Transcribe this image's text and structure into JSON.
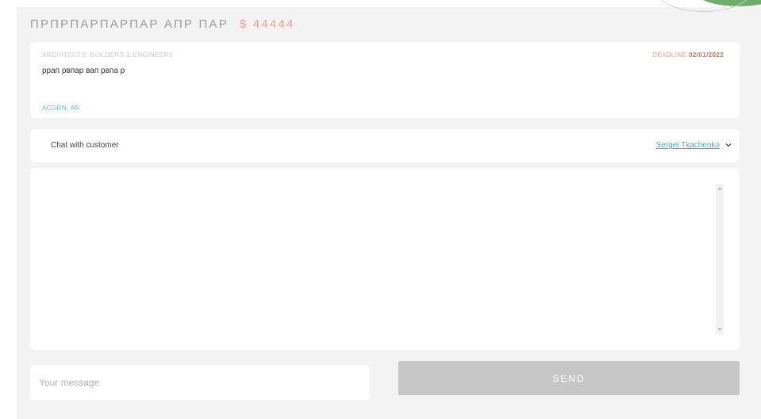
{
  "header": {
    "title": "ПРПРПАРПАРПАР АПР ПАР",
    "price": "$ 44444"
  },
  "job": {
    "category": "ARCHITECTS, BUILDERS & ENGINEERS",
    "deadline_label": "DEADLINE",
    "deadline_date": "02/01/2022",
    "description": "ppап рвпар вап рвпа р",
    "location": "ACORN, AR"
  },
  "chat": {
    "label": "Chat with customer",
    "user": "Sergei Tkachenko",
    "messages": []
  },
  "composer": {
    "placeholder": "Your message",
    "value": "",
    "send_label": "SEND"
  },
  "colors": {
    "price": "#f0a08a",
    "deadline": "#e06a4f",
    "accent": "#4aaebd",
    "send_disabled": "#c6c6c6",
    "decor_green": "#6fae6a"
  }
}
